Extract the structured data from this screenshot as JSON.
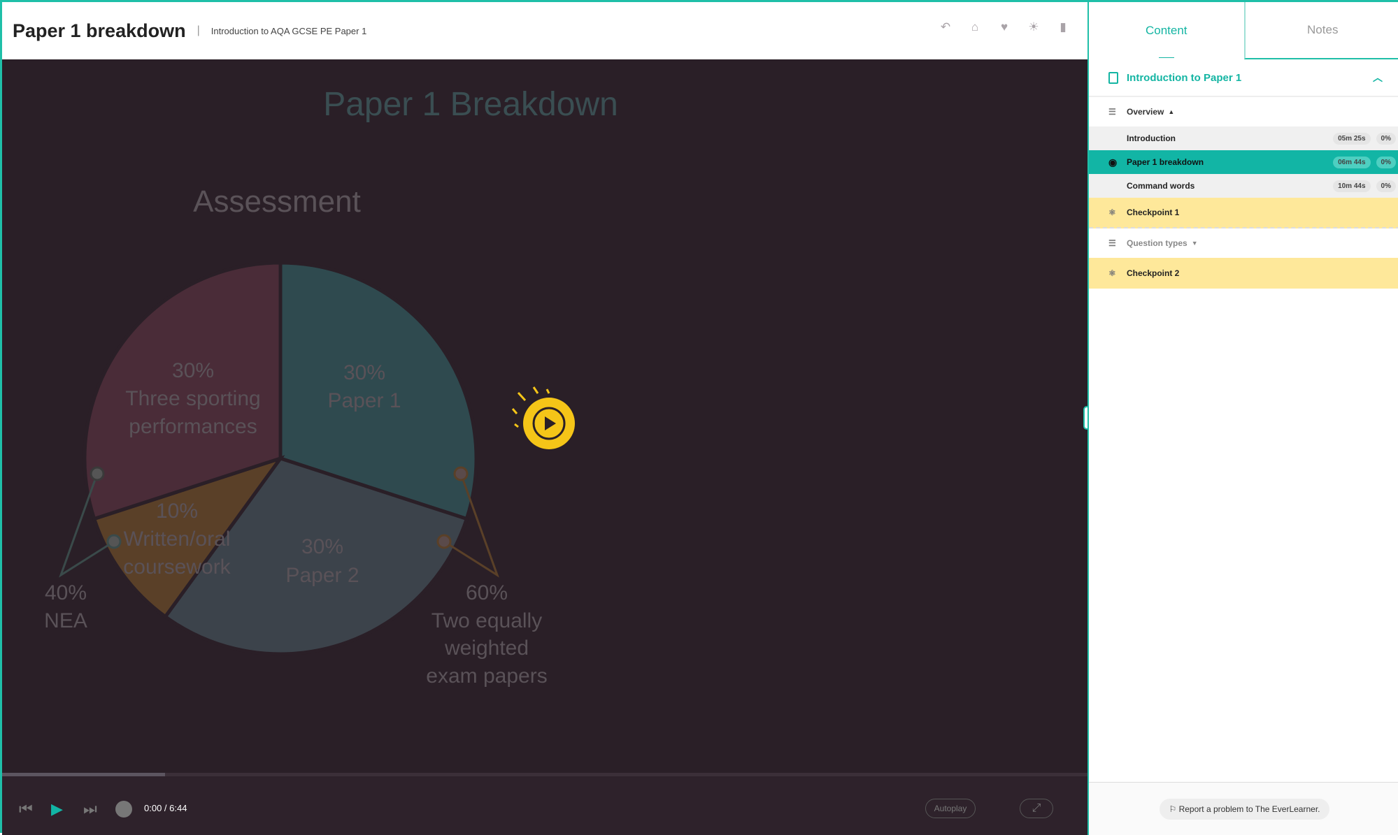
{
  "header": {
    "title": "Paper 1 breakdown",
    "subtitle": "Introduction to AQA GCSE PE Paper 1",
    "icons": [
      "undo-icon",
      "home-icon",
      "heart-icon",
      "brightness-icon",
      "sidebar-toggle-icon"
    ]
  },
  "slide": {
    "title": "Paper 1 Breakdown",
    "heading": "Assessment",
    "slices": [
      {
        "percent": "30%",
        "label": "Paper 1",
        "color": "#2f4a4f"
      },
      {
        "percent": "30%",
        "label": "Paper 2",
        "color": "#3c434b"
      },
      {
        "percent": "10%",
        "label": "Written/oral coursework",
        "color": "#5a4028"
      },
      {
        "percent": "30%",
        "label": "Three sporting performances",
        "color": "#4a2c38"
      }
    ],
    "callouts": {
      "nea_percent": "40%",
      "nea_label": "NEA",
      "exam_percent": "60%",
      "exam_label_1": "Two equally",
      "exam_label_2": "weighted",
      "exam_label_3": "exam papers"
    },
    "label_lines": {
      "three_1": "Three sporting",
      "three_2": "performances",
      "written_1": "Written/oral",
      "written_2": "coursework"
    }
  },
  "player": {
    "time": "0:00 / 6:44",
    "progress": 0.15,
    "autoplay": "Autoplay",
    "accent": "#12b5a5"
  },
  "sidebar": {
    "tabs": [
      "Content",
      "Notes"
    ],
    "module": "Introduction to Paper 1",
    "sections": [
      {
        "title": "Overview"
      },
      {
        "title": "Question types"
      }
    ],
    "items": [
      {
        "title": "Introduction",
        "duration": "05m 25s",
        "progress": "0%"
      },
      {
        "title": "Paper 1 breakdown",
        "duration": "06m 44s",
        "progress": "0%"
      },
      {
        "title": "Command words",
        "duration": "10m 44s",
        "progress": "0%"
      }
    ],
    "checkpoints": [
      "Checkpoint 1",
      "Checkpoint 2"
    ],
    "report": "Report a problem to The EverLearner."
  }
}
